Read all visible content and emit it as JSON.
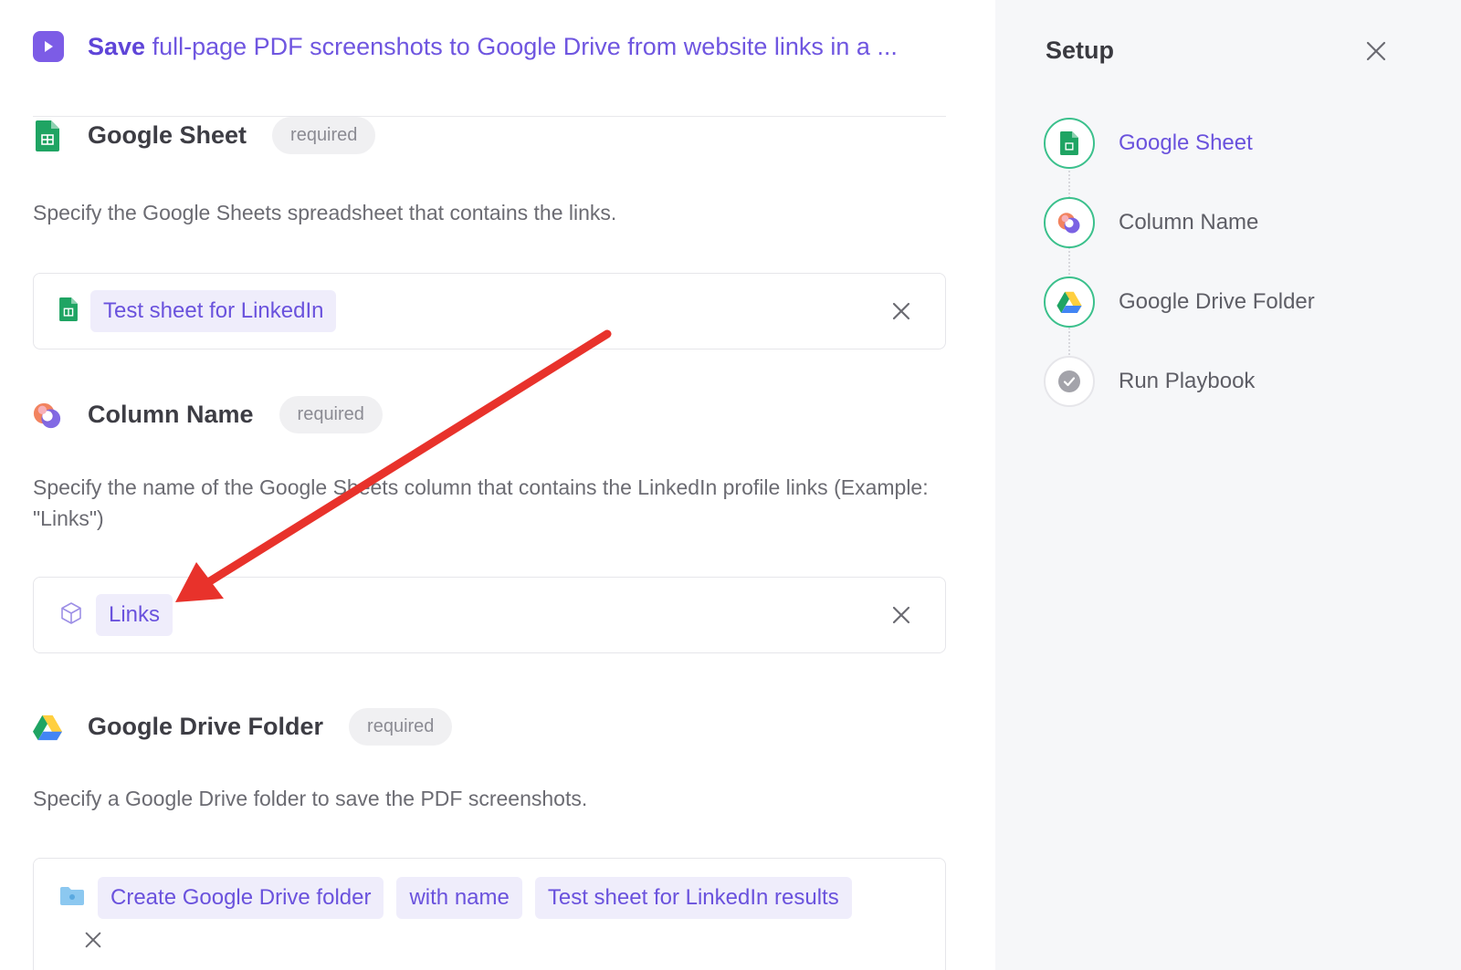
{
  "header": {
    "title_bold": "Save",
    "title_rest": " full-page PDF screenshots to Google Drive from website links in a ..."
  },
  "sections": {
    "sheet": {
      "title": "Google Sheet",
      "badge": "required",
      "description": "Specify the Google Sheets spreadsheet that contains the links.",
      "value_chip": "Test sheet for LinkedIn"
    },
    "column": {
      "title": "Column Name",
      "badge": "required",
      "description": "Specify the name of the Google Sheets column that contains the LinkedIn profile links (Example: \"Links\")",
      "value_chip": "Links"
    },
    "drive": {
      "title": "Google Drive Folder",
      "badge": "required",
      "description": "Specify a Google Drive folder to save the PDF screenshots.",
      "chips": [
        "Create Google Drive folder",
        "with name",
        "Test sheet for LinkedIn results"
      ]
    }
  },
  "sidebar": {
    "title": "Setup",
    "steps": [
      {
        "label": "Google Sheet",
        "state": "active",
        "icon": "google-sheets-icon"
      },
      {
        "label": "Column Name",
        "state": "done",
        "icon": "column-icon"
      },
      {
        "label": "Google Drive Folder",
        "state": "done",
        "icon": "google-drive-icon"
      },
      {
        "label": "Run Playbook",
        "state": "pending",
        "icon": "check-circle-icon"
      }
    ]
  },
  "colors": {
    "accent": "#6a52dd",
    "success": "#3bc08c",
    "annotation_arrow": "#e8322b"
  }
}
